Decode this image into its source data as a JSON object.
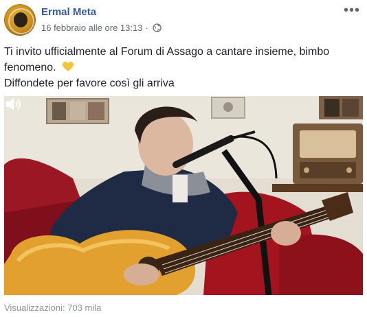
{
  "post": {
    "author": "Ermal Meta",
    "timestamp": "16 febbraio alle ore 13:13",
    "separator": "·",
    "privacy_icon": "globe-icon",
    "more_icon": "more-options-icon",
    "text_line1": "Ti invito ufficialmente al Forum di Assago a cantare insieme, bimbo fenomeno.",
    "text_emoji": "yellow-heart-icon",
    "text_line2": "Diffondete per favore così gli arriva",
    "video": {
      "sound_icon": "speaker-icon"
    },
    "views": "Visualizzazioni: 703 mila"
  },
  "colors": {
    "author": "#385898",
    "meta": "#606770",
    "views": "#90949c",
    "heart": "#f5c33b"
  }
}
